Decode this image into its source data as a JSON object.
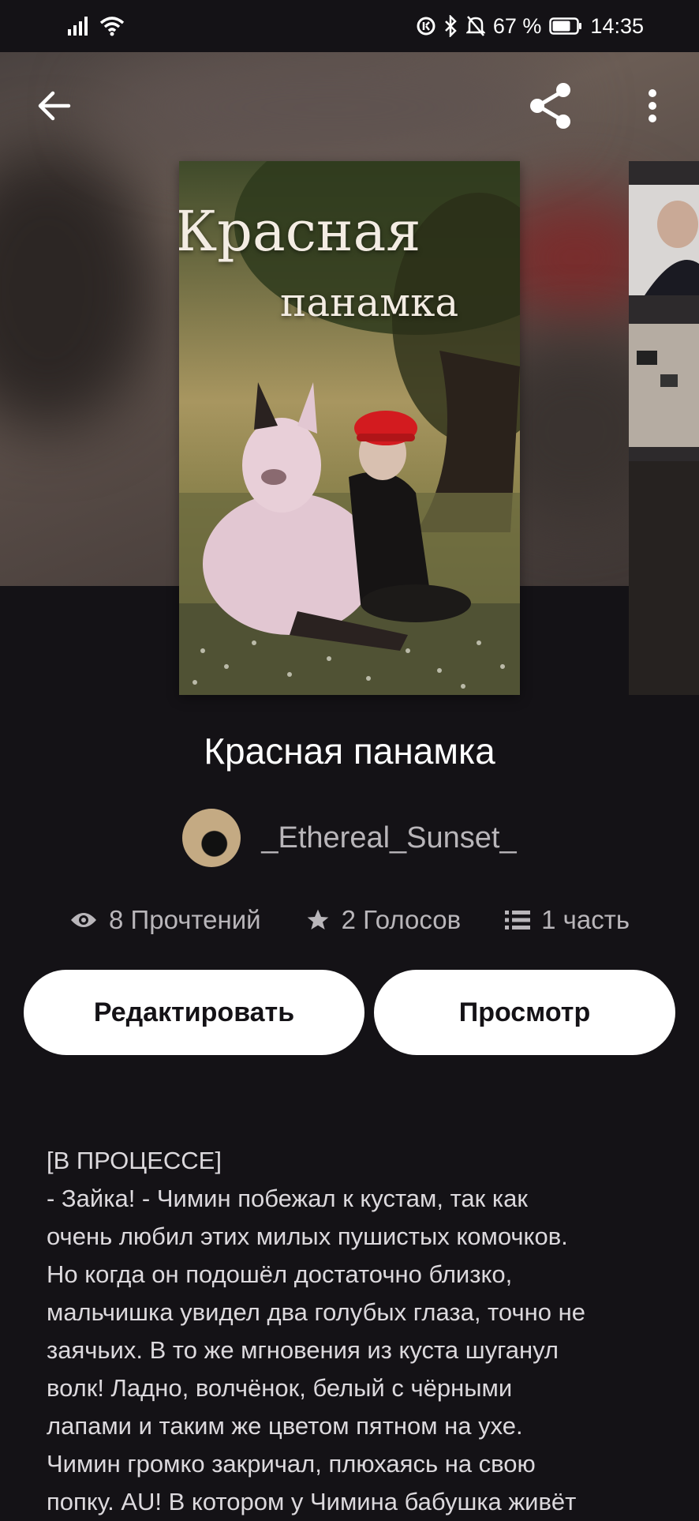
{
  "status_bar": {
    "battery": "67 %",
    "time": "14:35"
  },
  "app_bar": {
    "back_icon": "arrow-left-icon",
    "share_icon": "share-icon",
    "menu_icon": "more-vertical-icon"
  },
  "cover": {
    "title_line1": "Красная",
    "title_line2": "панамка"
  },
  "book": {
    "title": "Красная панамка",
    "author": "_Ethereal_Sunset_"
  },
  "stats": {
    "reads": "8 Прочтений",
    "votes": "2 Голосов",
    "parts": "1 часть"
  },
  "buttons": {
    "edit": "Редактировать",
    "view": "Просмотр"
  },
  "description": "[В ПРОЦЕССЕ]\n- Зайка! - Чимин побежал к кустам, так как\nочень любил этих милых пушистых комочков.\nНо когда он подошёл достаточно близко,\nмальчишка увидел два голубых глаза, точно не\nзаячьих. В то же мгновения из куста шуганул\nволк! Ладно, волчёнок, белый с чёрными\nлапами и таким же цветом пятном на ухе.\nЧимин громко закричал, плюхаясь на свою\nпопку. AU! В котором у Чимина бабушка живёт",
  "colors": {
    "background": "#141216",
    "button_bg": "#ffffff",
    "muted_text": "#b9b6ba"
  }
}
